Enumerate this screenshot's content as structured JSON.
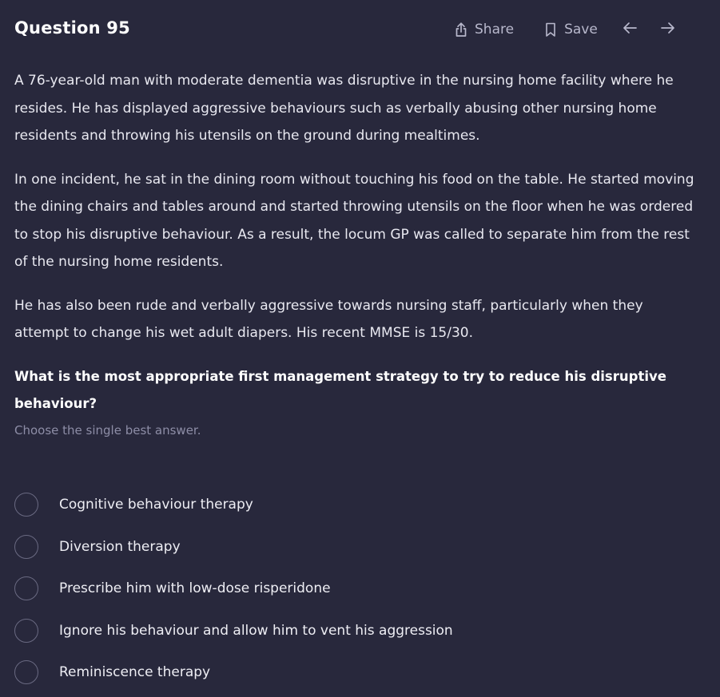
{
  "header": {
    "title": "Question 95",
    "share_label": "Share",
    "save_label": "Save",
    "share_icon": "share-icon",
    "save_icon": "bookmark-icon",
    "prev_icon": "arrow-left-icon",
    "next_icon": "arrow-right-icon"
  },
  "stem": {
    "paragraphs": [
      "A 76-year-old man with moderate dementia was disruptive in the nursing home facility where he resides. He has displayed aggressive behaviours such as verbally abusing other nursing home residents and throwing his utensils on the ground during mealtimes.",
      "In one incident, he sat in the dining room without touching his food on the table. He started moving the dining chairs and tables around and started throwing utensils on the floor when he was ordered to stop his disruptive behaviour. As a result, the locum GP was called to separate him from the rest of the nursing home residents.",
      "He has also been rude and verbally aggressive towards nursing staff, particularly when they attempt to change his wet adult diapers. His recent MMSE is 15/30."
    ],
    "question": "What is the most appropriate first management strategy to try to reduce his disruptive behaviour?",
    "instruction": "Choose the single best answer."
  },
  "options": [
    {
      "label": "Cognitive behaviour therapy",
      "selected": false
    },
    {
      "label": "Diversion therapy",
      "selected": false
    },
    {
      "label": "Prescribe him with low-dose risperidone",
      "selected": false
    },
    {
      "label": "Ignore his behaviour and allow him to vent his aggression",
      "selected": false
    },
    {
      "label": "Reminiscence therapy",
      "selected": false
    }
  ],
  "colors": {
    "background": "#28283c",
    "text": "#e8e8f0",
    "muted": "#8d8da6",
    "radio_border": "#6a6a82"
  }
}
